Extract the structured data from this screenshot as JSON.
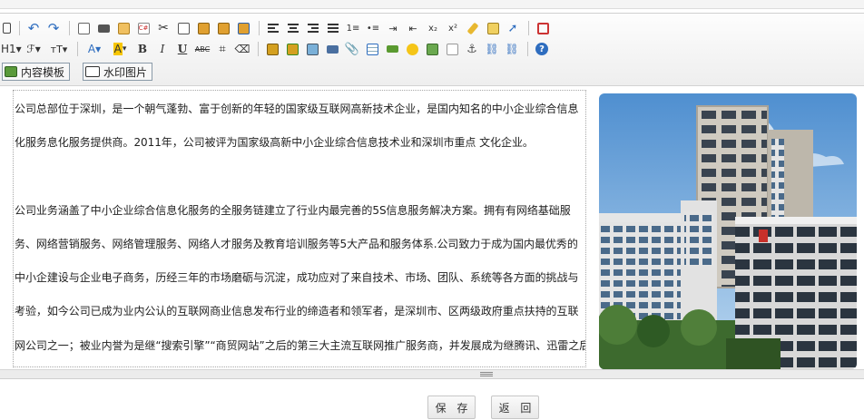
{
  "toolbar": {
    "row3": {
      "template_label": "内容模板",
      "watermark_label": "水印图片"
    }
  },
  "content": {
    "paragraph1": [
      "公司总部位于深圳，是一个朝气蓬勃、富于创新的年轻的国家级互联网高新技术企业，是国内知名的中小企业综合信息",
      "化服务息化服务提供商。2011年，公司被评为国家级高新中小企业综合信息技术业和深圳市重点 文化企业。"
    ],
    "paragraph2": [
      "公司业务涵盖了中小企业综合信息化服务的全服务链建立了行业内最完善的5S信息服务解决方案。拥有有网络基础服",
      "务、网络营销服务、网络管理服务、网络人才服务及教育培训服务等5大产品和服务体系.公司致力于成为国内最优秀的",
      "中小企建设与企业电子商务，历经三年的市场磨砺与沉淀，成功应对了来自技术、市场、团队、系统等各方面的挑战与",
      "考验，如今公司已成为业内公认的互联网商业信息发布行业的缔造者和领军者，是深圳市、区两级政府重点扶持的互联",
      "网公司之一；被业内誉为是继“搜索引擎”“商贸网站”之后的第三大主流互联网推广服务商，并发展成为继腾讯、迅雷之后"
    ]
  },
  "footer": {
    "save_label": "保 存",
    "back_label": "返 回"
  }
}
